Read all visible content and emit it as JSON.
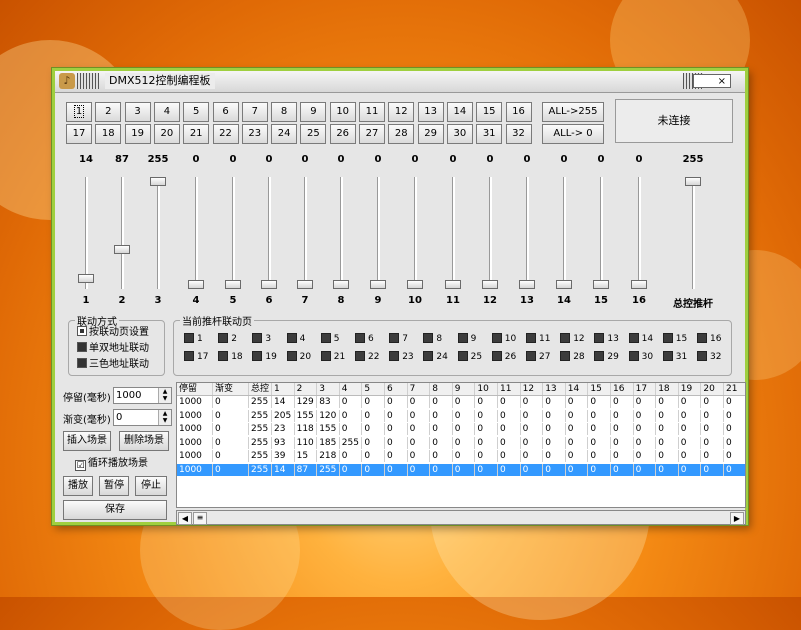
{
  "window": {
    "title": "DMX512控制编程板",
    "close": "×"
  },
  "channel_buttons": [
    "1",
    "2",
    "3",
    "4",
    "5",
    "6",
    "7",
    "8",
    "9",
    "10",
    "11",
    "12",
    "13",
    "14",
    "15",
    "16",
    "17",
    "18",
    "19",
    "20",
    "21",
    "22",
    "23",
    "24",
    "25",
    "26",
    "27",
    "28",
    "29",
    "30",
    "31",
    "32"
  ],
  "all_buttons": {
    "all_on": "ALL->255",
    "all_off": "ALL-> 0"
  },
  "status": "未连接",
  "sliders": {
    "values": [
      "14",
      "87",
      "255",
      "0",
      "0",
      "0",
      "0",
      "0",
      "0",
      "0",
      "0",
      "0",
      "0",
      "0",
      "0",
      "0"
    ],
    "levels": [
      14,
      87,
      255,
      0,
      0,
      0,
      0,
      0,
      0,
      0,
      0,
      0,
      0,
      0,
      0,
      0
    ],
    "labels": [
      "1",
      "2",
      "3",
      "4",
      "5",
      "6",
      "7",
      "8",
      "9",
      "10",
      "11",
      "12",
      "13",
      "14",
      "15",
      "16"
    ],
    "master": {
      "value": "255",
      "level": 255,
      "label": "总控推杆"
    }
  },
  "link_mode": {
    "title": "联动方式",
    "options": [
      "按联动页设置",
      "单双地址联动",
      "三色地址联动"
    ],
    "selected": 0
  },
  "link_page": {
    "title": "当前推杆联动页",
    "items": [
      "1",
      "2",
      "3",
      "4",
      "5",
      "6",
      "7",
      "8",
      "9",
      "10",
      "11",
      "12",
      "13",
      "14",
      "15",
      "16",
      "17",
      "18",
      "19",
      "20",
      "21",
      "22",
      "23",
      "24",
      "25",
      "26",
      "27",
      "28",
      "29",
      "30",
      "31",
      "32"
    ]
  },
  "controls": {
    "dwell_label": "停留(毫秒)",
    "dwell_value": "1000",
    "fade_label": "渐变(毫秒)",
    "fade_value": "0",
    "insert": "插入场景",
    "delete": "删除场景",
    "loop_label": "循环播放场景",
    "loop_checked": "☑",
    "play": "播放",
    "pause": "暂停",
    "stop": "停止",
    "save": "保存"
  },
  "scene_table": {
    "headers": [
      "停留",
      "渐变",
      "总控",
      "1",
      "2",
      "3",
      "4",
      "5",
      "6",
      "7",
      "8",
      "9",
      "10",
      "11",
      "12",
      "13",
      "14",
      "15",
      "16",
      "17",
      "18",
      "19",
      "20",
      "21"
    ],
    "rows": [
      [
        "1000",
        "0",
        "255",
        "14",
        "129",
        "83",
        "0",
        "0",
        "0",
        "0",
        "0",
        "0",
        "0",
        "0",
        "0",
        "0",
        "0",
        "0",
        "0",
        "0",
        "0",
        "0",
        "0",
        "0"
      ],
      [
        "1000",
        "0",
        "255",
        "205",
        "155",
        "120",
        "0",
        "0",
        "0",
        "0",
        "0",
        "0",
        "0",
        "0",
        "0",
        "0",
        "0",
        "0",
        "0",
        "0",
        "0",
        "0",
        "0",
        "0"
      ],
      [
        "1000",
        "0",
        "255",
        "23",
        "118",
        "155",
        "0",
        "0",
        "0",
        "0",
        "0",
        "0",
        "0",
        "0",
        "0",
        "0",
        "0",
        "0",
        "0",
        "0",
        "0",
        "0",
        "0",
        "0"
      ],
      [
        "1000",
        "0",
        "255",
        "93",
        "110",
        "185",
        "255",
        "0",
        "0",
        "0",
        "0",
        "0",
        "0",
        "0",
        "0",
        "0",
        "0",
        "0",
        "0",
        "0",
        "0",
        "0",
        "0",
        "0"
      ],
      [
        "1000",
        "0",
        "255",
        "39",
        "15",
        "218",
        "0",
        "0",
        "0",
        "0",
        "0",
        "0",
        "0",
        "0",
        "0",
        "0",
        "0",
        "0",
        "0",
        "0",
        "0",
        "0",
        "0",
        "0"
      ],
      [
        "1000",
        "0",
        "255",
        "14",
        "87",
        "255",
        "0",
        "0",
        "0",
        "0",
        "0",
        "0",
        "0",
        "0",
        "0",
        "0",
        "0",
        "0",
        "0",
        "0",
        "0",
        "0",
        "0",
        "0"
      ]
    ],
    "selected_row": 5
  }
}
